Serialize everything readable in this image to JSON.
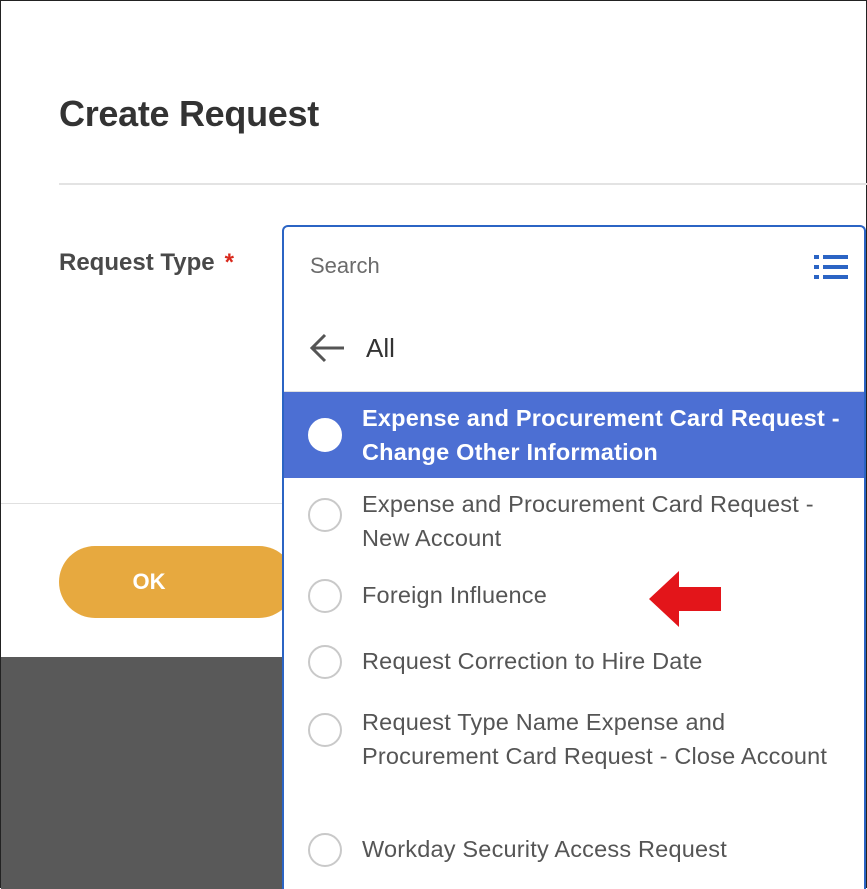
{
  "dialog": {
    "title": "Create Request",
    "ok_label": "OK"
  },
  "form": {
    "request_type_label": "Request Type",
    "required_marker": "*",
    "search_placeholder": "Search"
  },
  "dropdown": {
    "back_label": "All",
    "options": [
      {
        "label": "Expense and Procurement Card Request - Change Other Information",
        "selected": true
      },
      {
        "label": "Expense and Procurement Card Request - New Account",
        "selected": false
      },
      {
        "label": "Foreign Influence",
        "selected": false
      },
      {
        "label": "Request Correction to Hire Date",
        "selected": false
      },
      {
        "label": "Request Type Name Expense and Procurement Card Request - Close Account",
        "selected": false
      },
      {
        "label": "Workday Security Access Request",
        "selected": false
      }
    ]
  },
  "annotation": {
    "arrow_icon": "red-arrow-pointing-left",
    "arrow_color": "#e3151a"
  },
  "colors": {
    "accent": "#2b64c4",
    "selected_bg": "#4c6fd3",
    "ok_button": "#e7a93f",
    "required": "#d9291c"
  }
}
